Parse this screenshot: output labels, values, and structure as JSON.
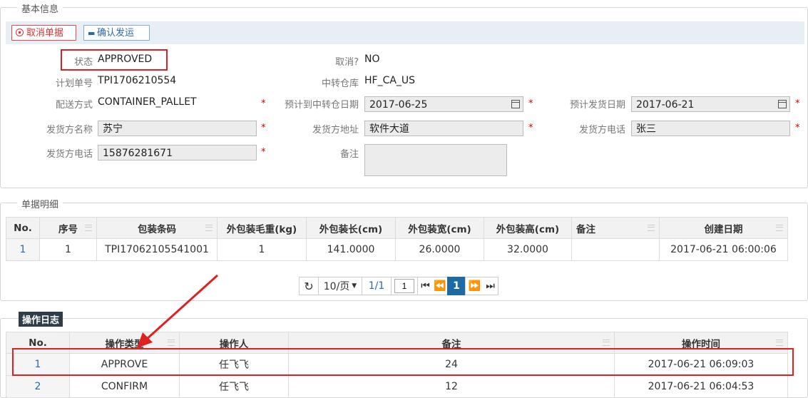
{
  "basic": {
    "legend": "基本信息",
    "cancel_btn": "取消单据",
    "confirm_btn": "确认发运",
    "status_label": "状态",
    "status_value": "APPROVED",
    "cancelled_label": "取消?",
    "cancelled_value": "NO",
    "plan_no_label": "计划单号",
    "plan_no_value": "TPI1706210554",
    "transit_wh_label": "中转仓库",
    "transit_wh_value": "HF_CA_US",
    "ship_method_label": "配送方式",
    "ship_method_value": "CONTAINER_PALLET",
    "eta_label": "预计到中转仓日期",
    "eta_value": "2017-06-25",
    "etd_label": "预计发货日期",
    "etd_value": "2017-06-21",
    "shipper_name_label": "发货方名称",
    "shipper_name_value": "苏宁",
    "shipper_addr_label": "发货方地址",
    "shipper_addr_value": "软件大道",
    "shipper_phone_label": "发货方电话",
    "shipper_phone_value": "张三",
    "shipper_tel_label": "发货方电话",
    "shipper_tel_value": "15876281671",
    "remark_label": "备注",
    "remark_value": "",
    "required_mark": "*"
  },
  "details": {
    "legend": "单据明细",
    "columns": [
      "No.",
      "序号",
      "包装条码",
      "外包装毛重(kg)",
      "外包装长(cm)",
      "外包装宽(cm)",
      "外包装高(cm)",
      "备注",
      "创建日期"
    ],
    "rows": [
      [
        "1",
        "1",
        "TPI17062105541001",
        "1",
        "141.0000",
        "26.0000",
        "32.0000",
        "",
        "2017-06-21 06:00:06"
      ]
    ]
  },
  "pager": {
    "page_size": "10/页",
    "page_info": "1/1",
    "page_input": "1",
    "current_page": "1"
  },
  "log": {
    "legend": "操作日志",
    "columns": [
      "No.",
      "操作类型",
      "操作人",
      "备注",
      "操作时间"
    ],
    "rows": [
      [
        "1",
        "APPROVE",
        "任飞飞",
        "24",
        "2017-06-21 06:09:03"
      ],
      [
        "2",
        "CONFIRM",
        "任飞飞",
        "12",
        "2017-06-21 06:04:53"
      ]
    ]
  },
  "colors": {
    "highlight": "#e02020",
    "accent": "#1e6aa3",
    "toolbar_bg": "#e8eef5"
  }
}
